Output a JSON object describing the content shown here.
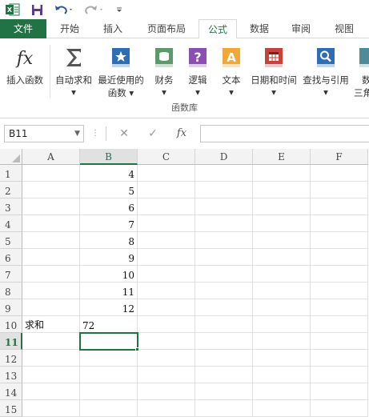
{
  "qat": {
    "icons": [
      "excel-logo-icon",
      "save-icon",
      "undo-icon",
      "redo-icon",
      "customize-qat-icon"
    ]
  },
  "tabs": [
    "文件",
    "开始",
    "插入",
    "页面布局",
    "公式",
    "数据",
    "审阅",
    "视图"
  ],
  "active_tab": "公式",
  "ribbon": {
    "buttons": [
      {
        "label": "插入函数",
        "label2": "",
        "icon": "fx-icon"
      },
      {
        "label": "自动求和",
        "label2": "▾",
        "icon": "sigma-icon"
      },
      {
        "label": "最近使用的",
        "label2": "函数 ▾",
        "icon": "star-book-icon"
      },
      {
        "label": "财务",
        "label2": "▾",
        "icon": "finance-book-icon"
      },
      {
        "label": "逻辑",
        "label2": "▾",
        "icon": "logic-book-icon"
      },
      {
        "label": "文本",
        "label2": "▾",
        "icon": "text-book-icon"
      },
      {
        "label": "日期和时间",
        "label2": "▾",
        "icon": "calendar-book-icon"
      },
      {
        "label": "查找与引用",
        "label2": "▾",
        "icon": "lookup-book-icon"
      },
      {
        "label": "数",
        "label2": "三角",
        "icon": "math-book-icon"
      }
    ],
    "group_label": "函数库"
  },
  "formula_bar": {
    "name_box": "B11",
    "cancel": "✕",
    "enter": "✓",
    "fx": "fx",
    "formula": ""
  },
  "grid": {
    "columns": [
      "A",
      "B",
      "C",
      "D",
      "E",
      "F"
    ],
    "selected_column": "B",
    "rows": [
      "1",
      "2",
      "3",
      "4",
      "5",
      "6",
      "7",
      "8",
      "9",
      "10",
      "11",
      "12",
      "13",
      "14",
      "15"
    ],
    "selected_row": "11",
    "cells": {
      "B1": "4",
      "B2": "5",
      "B3": "6",
      "B4": "7",
      "B5": "8",
      "B6": "9",
      "B7": "10",
      "B8": "11",
      "B9": "12",
      "A10": "求和",
      "B10": "72"
    },
    "active_cell": "B11"
  },
  "colors": {
    "accent": "#217346"
  }
}
